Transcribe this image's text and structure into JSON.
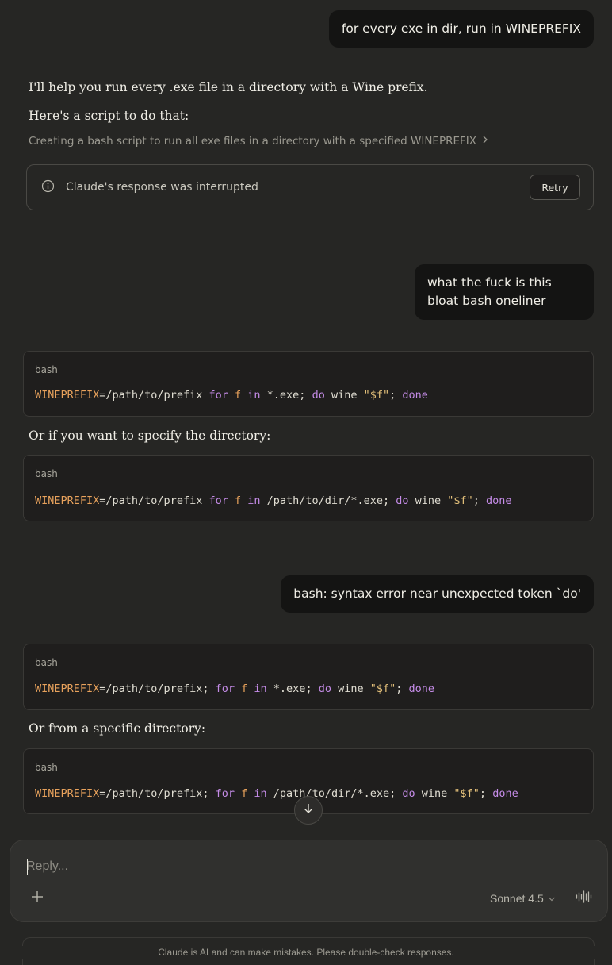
{
  "messages": {
    "user1": "for every exe in dir, run in WINEPREFIX",
    "assistant1_line1": "I'll help you run every .exe file in a directory with a Wine prefix.",
    "assistant1_line2": "Here's a script to do that:",
    "tool_step": "Creating a bash script to run all exe files in a directory with a specified WINEPREFIX",
    "interrupted_text": "Claude's response was interrupted",
    "retry_label": "Retry",
    "user2": "what the fuck is this bloat bash oneliner",
    "assistant2_between": "Or if you want to specify the directory:",
    "user3": "bash: syntax error near unexpected token `do'",
    "assistant3_between": "Or from a specific directory:"
  },
  "code_blocks": [
    {
      "lang": "bash",
      "tokens": [
        {
          "t": "WINEPREFIX",
          "c": "var"
        },
        {
          "t": "=/path/to/prefix ",
          "c": "plain"
        },
        {
          "t": "for",
          "c": "kw"
        },
        {
          "t": " ",
          "c": "plain"
        },
        {
          "t": "f",
          "c": "var"
        },
        {
          "t": " ",
          "c": "plain"
        },
        {
          "t": "in",
          "c": "kw"
        },
        {
          "t": " *.exe; ",
          "c": "plain"
        },
        {
          "t": "do",
          "c": "kw"
        },
        {
          "t": " wine ",
          "c": "plain"
        },
        {
          "t": "\"$f\"",
          "c": "str"
        },
        {
          "t": "; ",
          "c": "plain"
        },
        {
          "t": "done",
          "c": "kw"
        }
      ]
    },
    {
      "lang": "bash",
      "tokens": [
        {
          "t": "WINEPREFIX",
          "c": "var"
        },
        {
          "t": "=/path/to/prefix ",
          "c": "plain"
        },
        {
          "t": "for",
          "c": "kw"
        },
        {
          "t": " ",
          "c": "plain"
        },
        {
          "t": "f",
          "c": "var"
        },
        {
          "t": " ",
          "c": "plain"
        },
        {
          "t": "in",
          "c": "kw"
        },
        {
          "t": " /path/to/dir/*.exe; ",
          "c": "plain"
        },
        {
          "t": "do",
          "c": "kw"
        },
        {
          "t": " wine ",
          "c": "plain"
        },
        {
          "t": "\"$f\"",
          "c": "str"
        },
        {
          "t": "; ",
          "c": "plain"
        },
        {
          "t": "done",
          "c": "kw"
        }
      ]
    },
    {
      "lang": "bash",
      "tokens": [
        {
          "t": "WINEPREFIX",
          "c": "var"
        },
        {
          "t": "=/path/to/prefix; ",
          "c": "plain"
        },
        {
          "t": "for",
          "c": "kw"
        },
        {
          "t": " ",
          "c": "plain"
        },
        {
          "t": "f",
          "c": "var"
        },
        {
          "t": " ",
          "c": "plain"
        },
        {
          "t": "in",
          "c": "kw"
        },
        {
          "t": " *.exe; ",
          "c": "plain"
        },
        {
          "t": "do",
          "c": "kw"
        },
        {
          "t": " wine ",
          "c": "plain"
        },
        {
          "t": "\"$f\"",
          "c": "str"
        },
        {
          "t": "; ",
          "c": "plain"
        },
        {
          "t": "done",
          "c": "kw"
        }
      ]
    },
    {
      "lang": "bash",
      "tokens": [
        {
          "t": "WINEPREFIX",
          "c": "var"
        },
        {
          "t": "=/path/to/prefix; ",
          "c": "plain"
        },
        {
          "t": "for",
          "c": "kw"
        },
        {
          "t": " ",
          "c": "plain"
        },
        {
          "t": "f",
          "c": "var"
        },
        {
          "t": " ",
          "c": "plain"
        },
        {
          "t": "in",
          "c": "kw"
        },
        {
          "t": " /path/to/dir/*.exe; ",
          "c": "plain"
        },
        {
          "t": "do",
          "c": "kw"
        },
        {
          "t": " wine ",
          "c": "plain"
        },
        {
          "t": "\"$f\"",
          "c": "str"
        },
        {
          "t": "; ",
          "c": "plain"
        },
        {
          "t": "done",
          "c": "kw"
        }
      ]
    }
  ],
  "composer": {
    "placeholder": "Reply...",
    "model": "Sonnet 4.5"
  },
  "footer": {
    "disclaimer": "Claude is AI and can make mistakes. Please double-check responses."
  },
  "icons": {
    "info": "info-icon",
    "chevron_right": "chevron-right-icon",
    "scroll_down": "arrow-down-icon",
    "plus": "plus-icon",
    "chevron_down": "chevron-down-icon",
    "voice": "waveform-icon"
  },
  "colors": {
    "background": "#262624",
    "user_bubble": "#141413",
    "code_bg": "#1f1e1d",
    "syntax_variable": "#e8a25c",
    "syntax_keyword": "#c58ce8",
    "syntax_string": "#e3c07a"
  }
}
